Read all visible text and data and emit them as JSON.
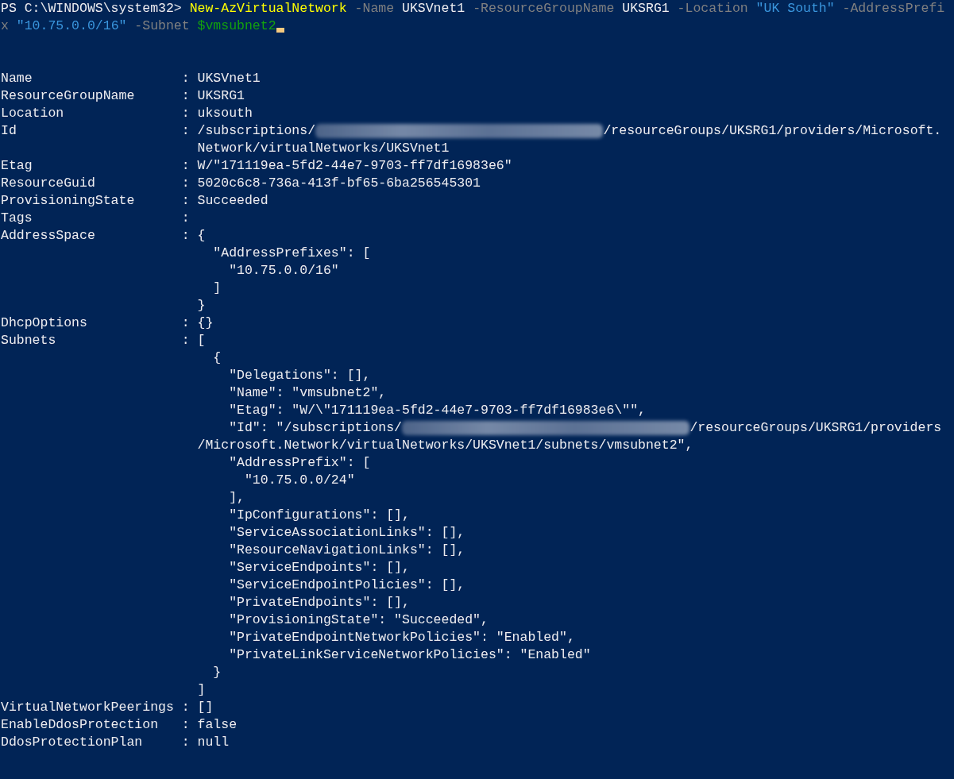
{
  "terminal": {
    "lines": [
      {
        "kind": "text",
        "segments": [
          {
            "kind": "prompt",
            "text": "PS C:\\WINDOWS\\system32> "
          },
          {
            "kind": "command",
            "text": "New-AzVirtualNetwork"
          },
          {
            "kind": "parameter",
            "text": " -Name"
          },
          {
            "kind": "plain",
            "text": " UKSVnet1"
          },
          {
            "kind": "parameter",
            "text": " -ResourceGroupName"
          },
          {
            "kind": "plain",
            "text": " UKSRG1"
          },
          {
            "kind": "parameter",
            "text": " -Location"
          },
          {
            "kind": "string",
            "text": " \"UK South\""
          },
          {
            "kind": "parameter",
            "text": " -AddressPrefi"
          }
        ]
      },
      {
        "kind": "text",
        "segments": [
          {
            "kind": "parameter",
            "text": "x"
          },
          {
            "kind": "string",
            "text": " \"10.75.0.0/16\""
          },
          {
            "kind": "parameter",
            "text": " -Subnet"
          },
          {
            "kind": "variable",
            "text": " $vmsubnet2"
          },
          {
            "kind": "cursor"
          }
        ]
      },
      {
        "kind": "blank"
      },
      {
        "kind": "blank"
      },
      {
        "kind": "text",
        "segments": [
          {
            "kind": "plain",
            "text": "Name                   : UKSVnet1"
          }
        ]
      },
      {
        "kind": "text",
        "segments": [
          {
            "kind": "plain",
            "text": "ResourceGroupName      : UKSRG1"
          }
        ]
      },
      {
        "kind": "text",
        "segments": [
          {
            "kind": "plain",
            "text": "Location               : uksouth"
          }
        ]
      },
      {
        "kind": "text",
        "segments": [
          {
            "kind": "plain",
            "text": "Id                     : /subscriptions/"
          },
          {
            "kind": "redacted"
          },
          {
            "kind": "plain",
            "text": "/resourceGroups/UKSRG1/providers/Microsoft."
          }
        ]
      },
      {
        "kind": "text",
        "segments": [
          {
            "kind": "plain",
            "text": "                         Network/virtualNetworks/UKSVnet1"
          }
        ]
      },
      {
        "kind": "text",
        "segments": [
          {
            "kind": "plain",
            "text": "Etag                   : W/\"171119ea-5fd2-44e7-9703-ff7df16983e6\""
          }
        ]
      },
      {
        "kind": "text",
        "segments": [
          {
            "kind": "plain",
            "text": "ResourceGuid           : 5020c6c8-736a-413f-bf65-6ba256545301"
          }
        ]
      },
      {
        "kind": "text",
        "segments": [
          {
            "kind": "plain",
            "text": "ProvisioningState      : Succeeded"
          }
        ]
      },
      {
        "kind": "text",
        "segments": [
          {
            "kind": "plain",
            "text": "Tags                   :"
          }
        ]
      },
      {
        "kind": "text",
        "segments": [
          {
            "kind": "plain",
            "text": "AddressSpace           : {"
          }
        ]
      },
      {
        "kind": "text",
        "segments": [
          {
            "kind": "plain",
            "text": "                           \"AddressPrefixes\": ["
          }
        ]
      },
      {
        "kind": "text",
        "segments": [
          {
            "kind": "plain",
            "text": "                             \"10.75.0.0/16\""
          }
        ]
      },
      {
        "kind": "text",
        "segments": [
          {
            "kind": "plain",
            "text": "                           ]"
          }
        ]
      },
      {
        "kind": "text",
        "segments": [
          {
            "kind": "plain",
            "text": "                         }"
          }
        ]
      },
      {
        "kind": "text",
        "segments": [
          {
            "kind": "plain",
            "text": "DhcpOptions            : {}"
          }
        ]
      },
      {
        "kind": "text",
        "segments": [
          {
            "kind": "plain",
            "text": "Subnets                : ["
          }
        ]
      },
      {
        "kind": "text",
        "segments": [
          {
            "kind": "plain",
            "text": "                           {"
          }
        ]
      },
      {
        "kind": "text",
        "segments": [
          {
            "kind": "plain",
            "text": "                             \"Delegations\": [],"
          }
        ]
      },
      {
        "kind": "text",
        "segments": [
          {
            "kind": "plain",
            "text": "                             \"Name\": \"vmsubnet2\","
          }
        ]
      },
      {
        "kind": "text",
        "segments": [
          {
            "kind": "plain",
            "text": "                             \"Etag\": \"W/\\\"171119ea-5fd2-44e7-9703-ff7df16983e6\\\"\","
          }
        ]
      },
      {
        "kind": "text",
        "segments": [
          {
            "kind": "plain",
            "text": "                             \"Id\": \"/subscriptions/"
          },
          {
            "kind": "redacted"
          },
          {
            "kind": "plain",
            "text": "/resourceGroups/UKSRG1/providers"
          }
        ]
      },
      {
        "kind": "text",
        "segments": [
          {
            "kind": "plain",
            "text": "                         /Microsoft.Network/virtualNetworks/UKSVnet1/subnets/vmsubnet2\","
          }
        ]
      },
      {
        "kind": "text",
        "segments": [
          {
            "kind": "plain",
            "text": "                             \"AddressPrefix\": ["
          }
        ]
      },
      {
        "kind": "text",
        "segments": [
          {
            "kind": "plain",
            "text": "                               \"10.75.0.0/24\""
          }
        ]
      },
      {
        "kind": "text",
        "segments": [
          {
            "kind": "plain",
            "text": "                             ],"
          }
        ]
      },
      {
        "kind": "text",
        "segments": [
          {
            "kind": "plain",
            "text": "                             \"IpConfigurations\": [],"
          }
        ]
      },
      {
        "kind": "text",
        "segments": [
          {
            "kind": "plain",
            "text": "                             \"ServiceAssociationLinks\": [],"
          }
        ]
      },
      {
        "kind": "text",
        "segments": [
          {
            "kind": "plain",
            "text": "                             \"ResourceNavigationLinks\": [],"
          }
        ]
      },
      {
        "kind": "text",
        "segments": [
          {
            "kind": "plain",
            "text": "                             \"ServiceEndpoints\": [],"
          }
        ]
      },
      {
        "kind": "text",
        "segments": [
          {
            "kind": "plain",
            "text": "                             \"ServiceEndpointPolicies\": [],"
          }
        ]
      },
      {
        "kind": "text",
        "segments": [
          {
            "kind": "plain",
            "text": "                             \"PrivateEndpoints\": [],"
          }
        ]
      },
      {
        "kind": "text",
        "segments": [
          {
            "kind": "plain",
            "text": "                             \"ProvisioningState\": \"Succeeded\","
          }
        ]
      },
      {
        "kind": "text",
        "segments": [
          {
            "kind": "plain",
            "text": "                             \"PrivateEndpointNetworkPolicies\": \"Enabled\","
          }
        ]
      },
      {
        "kind": "text",
        "segments": [
          {
            "kind": "plain",
            "text": "                             \"PrivateLinkServiceNetworkPolicies\": \"Enabled\""
          }
        ]
      },
      {
        "kind": "text",
        "segments": [
          {
            "kind": "plain",
            "text": "                           }"
          }
        ]
      },
      {
        "kind": "text",
        "segments": [
          {
            "kind": "plain",
            "text": "                         ]"
          }
        ]
      },
      {
        "kind": "text",
        "segments": [
          {
            "kind": "plain",
            "text": "VirtualNetworkPeerings : []"
          }
        ]
      },
      {
        "kind": "text",
        "segments": [
          {
            "kind": "plain",
            "text": "EnableDdosProtection   : false"
          }
        ]
      },
      {
        "kind": "text",
        "segments": [
          {
            "kind": "plain",
            "text": "DdosProtectionPlan     : null"
          }
        ]
      }
    ]
  }
}
